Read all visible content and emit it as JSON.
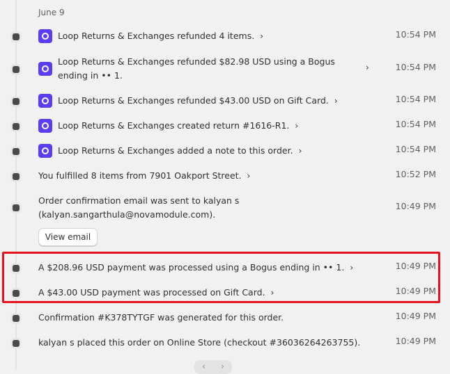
{
  "date_header": "June 9",
  "events": [
    {
      "text": "Loop Returns & Exchanges refunded 4 items.",
      "time": "10:54 PM"
    },
    {
      "text_line1": "Loop Returns & Exchanges refunded $82.98 USD using a Bogus",
      "text_line2": "ending in •• 1.",
      "time": "10:54 PM"
    },
    {
      "text": "Loop Returns & Exchanges refunded $43.00 USD on Gift Card.",
      "time": "10:54 PM"
    },
    {
      "text": "Loop Returns & Exchanges created return #1616-R1.",
      "time": "10:54 PM"
    },
    {
      "text": "Loop Returns & Exchanges added a note to this order.",
      "time": "10:54 PM"
    },
    {
      "text": "You fulfilled 8 items from 7901 Oakport Street.",
      "time": "10:52 PM"
    },
    {
      "text_line1": "Order confirmation email was sent to kalyan s",
      "text_line2": "(kalyan.sangarthula@novamodule.com).",
      "time": "10:49 PM",
      "button": "View email"
    },
    {
      "text": "A $208.96 USD payment was processed using a Bogus ending in •• 1.",
      "time": "10:49 PM"
    },
    {
      "text": "A $43.00 USD payment was processed on Gift Card.",
      "time": "10:49 PM"
    },
    {
      "text": "Confirmation #K378TYTGF was generated for this order.",
      "time": "10:49 PM"
    },
    {
      "text": "kalyan s placed this order on Online Store (checkout #36036264263755).",
      "time": "10:49 PM"
    }
  ],
  "icons": {
    "chevron": "›",
    "loop_icon_color": "#5b3df5",
    "highlight_color": "#e8101a",
    "pager_prev": "‹",
    "pager_next": "›"
  }
}
